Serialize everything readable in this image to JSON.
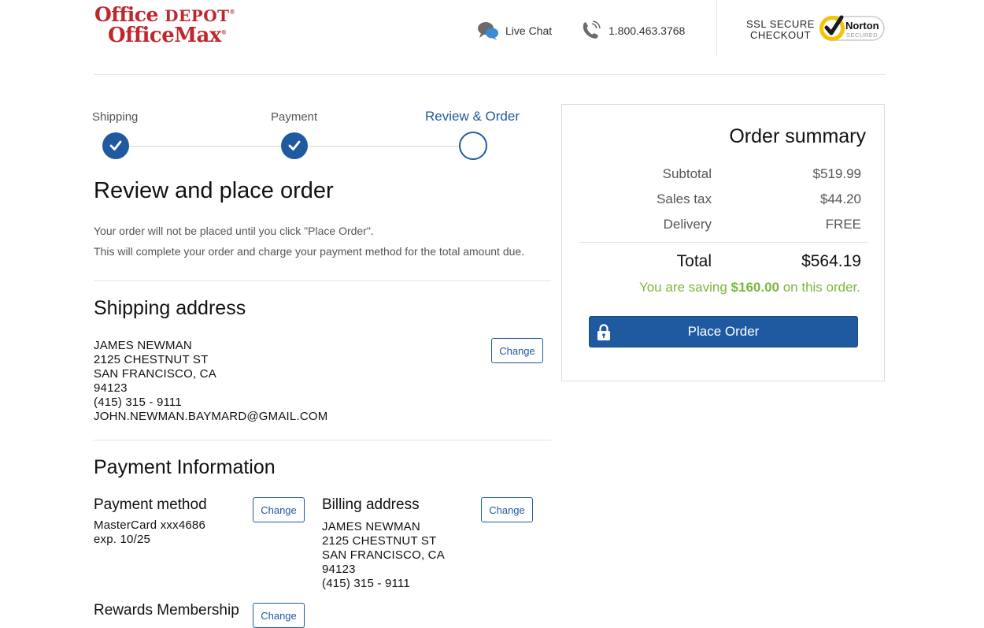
{
  "brand": {
    "logo_line1_a": "Office ",
    "logo_line1_b": "DEPOT",
    "logo_line2": "OfficeMax",
    "logo_mark": "®"
  },
  "header": {
    "chat_label": "Live Chat",
    "phone": "1.800.463.3768",
    "ssl_line1": "SSL SECURE",
    "ssl_line2": "CHECKOUT",
    "norton_line1": "Norton",
    "norton_line2": "SECURED"
  },
  "icons": {
    "chat": "chat-bubbles-icon",
    "phone": "phone-icon",
    "check": "check-icon",
    "lock": "lock-icon"
  },
  "steps": [
    {
      "label": "Shipping",
      "state": "done"
    },
    {
      "label": "Payment",
      "state": "done"
    },
    {
      "label": "Review & Order",
      "state": "current"
    }
  ],
  "review": {
    "title": "Review and place order",
    "note1": "Your order will not be placed until you click \"Place Order\".",
    "note2": "This will complete your order and charge your payment method for the total amount due."
  },
  "shipping": {
    "title": "Shipping address",
    "change_label": "Change",
    "lines": [
      "JAMES NEWMAN",
      "2125 CHESTNUT ST",
      "SAN FRANCISCO, CA",
      "94123",
      "(415) 315 - 9111",
      "JOHN.NEWMAN.BAYMARD@GMAIL.COM"
    ]
  },
  "payment": {
    "title": "Payment Information",
    "method_title": "Payment method",
    "method_lines": [
      "MasterCard xxx4686",
      "exp. 10/25"
    ],
    "billing_title": "Billing address",
    "billing_lines": [
      "JAMES NEWMAN",
      "2125 CHESTNUT ST",
      "SAN FRANCISCO, CA",
      "94123",
      "(415) 315 - 9111"
    ],
    "rewards_title": "Rewards Membership",
    "change_label": "Change"
  },
  "summary": {
    "title": "Order summary",
    "subtotal_label": "Subtotal",
    "subtotal": "$519.99",
    "tax_label": "Sales tax",
    "tax": "$44.20",
    "delivery_label": "Delivery",
    "delivery": "FREE",
    "total_label": "Total",
    "total": "$564.19",
    "saving_prefix": "You are saving ",
    "saving_amount": "$160.00",
    "saving_suffix": " on this order.",
    "place_order_label": "Place Order"
  },
  "colors": {
    "brand_red": "#c0272d",
    "primary_blue": "#1f5aa0",
    "saving_green": "#79b83b",
    "norton_yellow": "#f5c400"
  }
}
